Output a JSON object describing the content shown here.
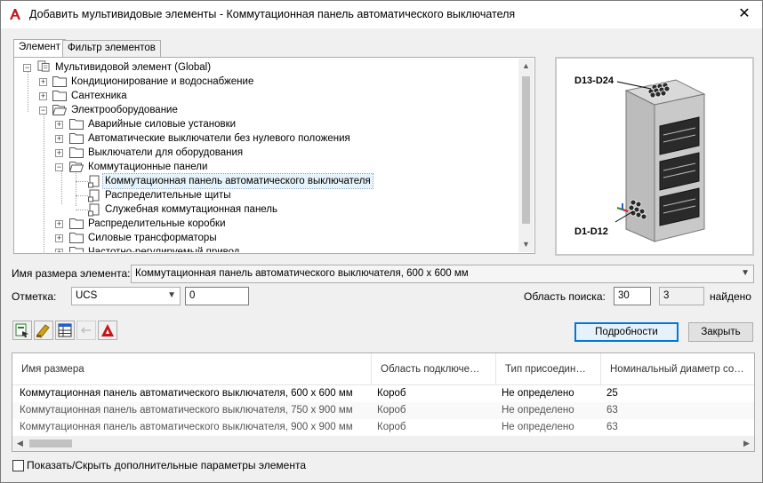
{
  "window": {
    "title": "Добавить мультивидовые элементы - Коммутационная панель автоматического выключателя",
    "close_glyph": "✕"
  },
  "tabs": [
    {
      "label": "Элемент",
      "active": true
    },
    {
      "label": "Фильтр элементов",
      "active": false
    }
  ],
  "tree": {
    "root": "Мультивидовой элемент (Global)",
    "items": [
      {
        "label": "Кондиционирование и водоснабжение"
      },
      {
        "label": "Сантехника"
      },
      {
        "label": "Электрооборудование"
      },
      {
        "label": "Аварийные силовые установки"
      },
      {
        "label": "Автоматические выключатели без нулевого положения"
      },
      {
        "label": "Выключатели для оборудования"
      },
      {
        "label": "Коммутационные панели"
      },
      {
        "label": "Коммутационная панель автоматического выключателя",
        "selected": true
      },
      {
        "label": "Распределительные щиты"
      },
      {
        "label": "Служебная коммутационная панель"
      },
      {
        "label": "Распределительные коробки"
      },
      {
        "label": "Силовые трансформаторы"
      },
      {
        "label": "Частотно-регулируемый привод"
      }
    ]
  },
  "preview": {
    "label_top": "D13-D24",
    "label_bottom": "D1-D12"
  },
  "size_field": {
    "label": "Имя размера элемента:",
    "value": "Коммутационная панель автоматического выключателя, 600 x 600 мм"
  },
  "elevation": {
    "label": "Отметка:",
    "ucs_value": "UCS",
    "value": "0"
  },
  "search_area": {
    "label": "Область поиска:",
    "value": "30",
    "found_count": "3",
    "found_label": "найдено"
  },
  "buttons": {
    "details": "Подробности",
    "close": "Закрыть"
  },
  "table": {
    "columns": [
      "Имя размера",
      "Область подключе…",
      "Тип присоедин…",
      "Номинальный диаметр со…"
    ],
    "rows": [
      [
        "Коммутационная панель автоматического выключателя, 600 x 600 мм",
        "Короб",
        "Не определено",
        "25"
      ],
      [
        "Коммутационная панель автоматического выключателя, 750 x 900 мм",
        "Короб",
        "Не определено",
        "63"
      ],
      [
        "Коммутационная панель автоматического выключателя, 900 x 900 мм",
        "Короб",
        "Не определено",
        "63"
      ]
    ]
  },
  "show_hide": {
    "label": "Показать/Скрыть дополнительные параметры элемента",
    "checked": false
  },
  "colors": {
    "selection_bg": "#e5f3fb",
    "default_button_border": "#0078d7",
    "app_icon": "#c4161c"
  }
}
